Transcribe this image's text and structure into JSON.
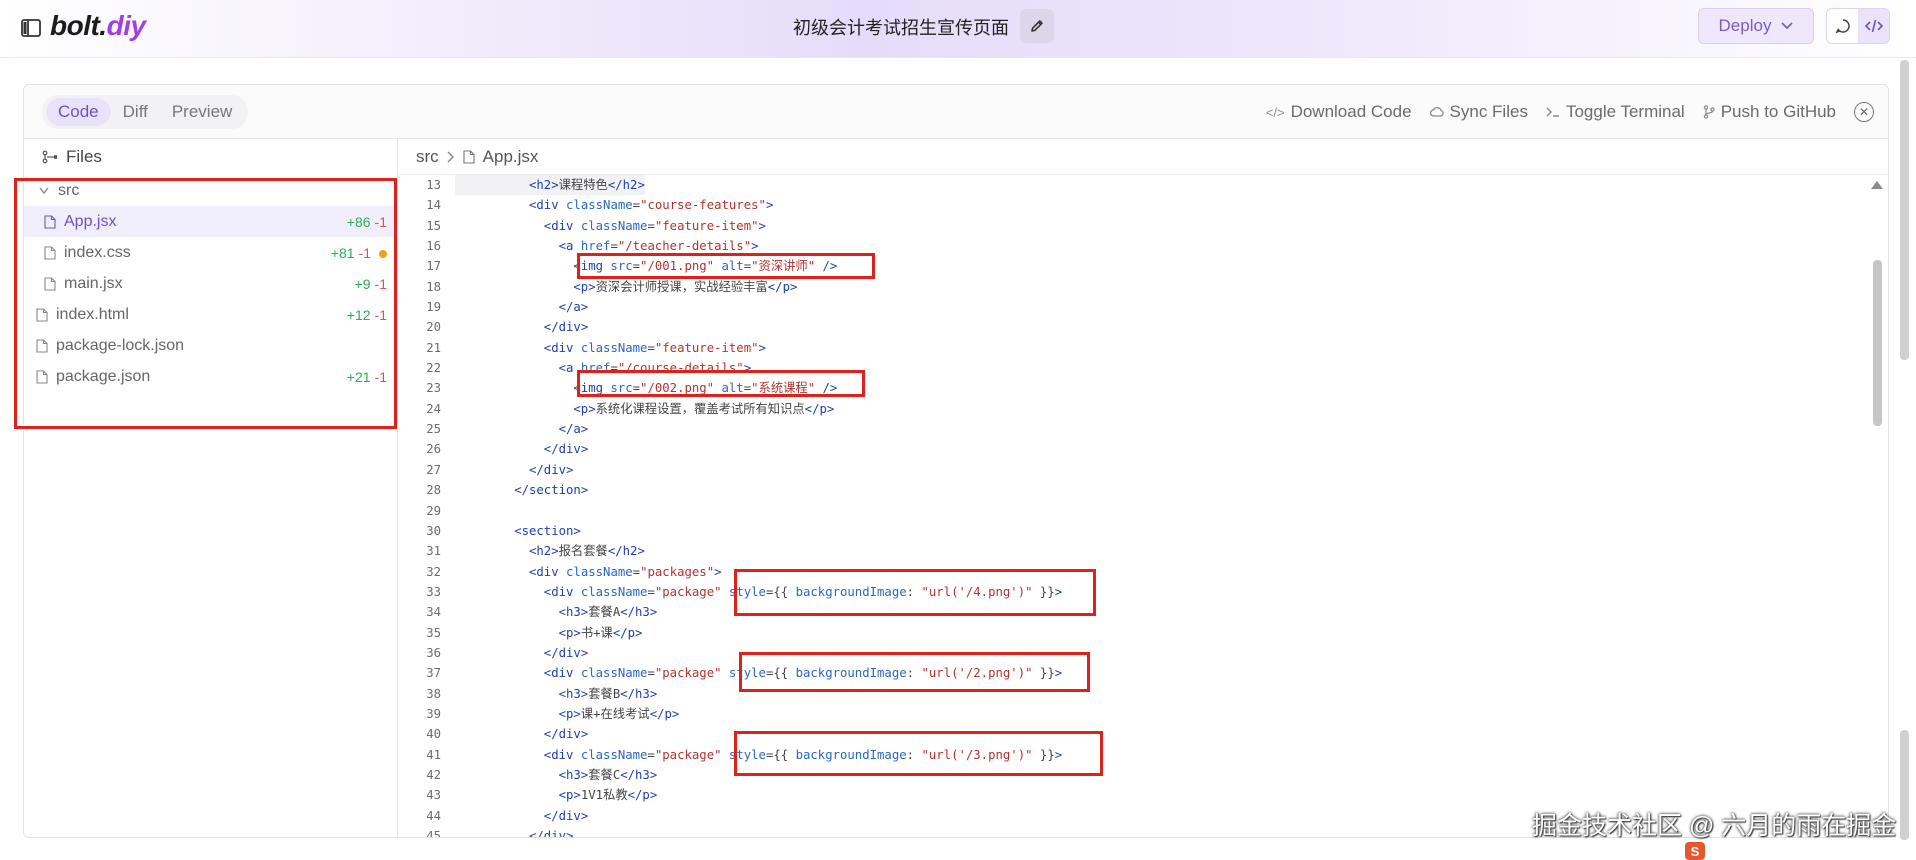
{
  "header": {
    "logo_main": "bolt.",
    "logo_accent": "diy",
    "project_title": "初级会计考试招生宣传页面",
    "deploy_label": "Deploy"
  },
  "workbench": {
    "tabs": [
      {
        "label": "Code",
        "active": true
      },
      {
        "label": "Diff",
        "active": false
      },
      {
        "label": "Preview",
        "active": false
      }
    ],
    "actions": {
      "download": "Download Code",
      "sync": "Sync Files",
      "terminal": "Toggle Terminal",
      "github": "Push to GitHub"
    }
  },
  "filetree": {
    "title": "Files",
    "items": [
      {
        "name": "src",
        "type": "folder",
        "indent": 0,
        "plus": "",
        "minus": "",
        "modified": false,
        "selected": false
      },
      {
        "name": "App.jsx",
        "type": "file",
        "indent": 1,
        "plus": "+86",
        "minus": "-1",
        "modified": false,
        "selected": true
      },
      {
        "name": "index.css",
        "type": "file",
        "indent": 1,
        "plus": "+81",
        "minus": "-1",
        "modified": true,
        "selected": false
      },
      {
        "name": "main.jsx",
        "type": "file",
        "indent": 1,
        "plus": "+9",
        "minus": "-1",
        "modified": false,
        "selected": false
      },
      {
        "name": "index.html",
        "type": "file",
        "indent": 0,
        "plus": "+12",
        "minus": "-1",
        "modified": false,
        "selected": false
      },
      {
        "name": "package-lock.json",
        "type": "file",
        "indent": 0,
        "plus": "",
        "minus": "",
        "modified": false,
        "selected": false
      },
      {
        "name": "package.json",
        "type": "file",
        "indent": 0,
        "plus": "+21",
        "minus": "-1",
        "modified": false,
        "selected": false
      }
    ]
  },
  "editor": {
    "breadcrumb": {
      "folder": "src",
      "file": "App.jsx"
    },
    "lines": [
      {
        "n": "13",
        "i": 5,
        "hl": true,
        "t": [
          [
            "tg",
            "<h2>"
          ],
          [
            "pu",
            "课程特色"
          ],
          [
            "tg",
            "</h2>"
          ]
        ]
      },
      {
        "n": "14",
        "i": 5,
        "t": [
          [
            "tg",
            "<div "
          ],
          [
            "at",
            "className"
          ],
          [
            "pu",
            "="
          ],
          [
            "st",
            "\"course-features\""
          ],
          [
            "tg",
            ">"
          ]
        ]
      },
      {
        "n": "15",
        "i": 6,
        "t": [
          [
            "tg",
            "<div "
          ],
          [
            "at",
            "className"
          ],
          [
            "pu",
            "="
          ],
          [
            "st",
            "\"feature-item\""
          ],
          [
            "tg",
            ">"
          ]
        ]
      },
      {
        "n": "16",
        "i": 7,
        "t": [
          [
            "tg",
            "<a "
          ],
          [
            "at",
            "href"
          ],
          [
            "pu",
            "="
          ],
          [
            "st",
            "\"/teacher-details\""
          ],
          [
            "tg",
            ">"
          ]
        ]
      },
      {
        "n": "17",
        "i": 8,
        "t": [
          [
            "tg",
            "<img "
          ],
          [
            "at",
            "src"
          ],
          [
            "pu",
            "="
          ],
          [
            "st",
            "\"/001.png\""
          ],
          [
            "pu",
            " "
          ],
          [
            "at",
            "alt"
          ],
          [
            "pu",
            "="
          ],
          [
            "st",
            "\"资深讲师\""
          ],
          [
            "tg",
            " />"
          ]
        ]
      },
      {
        "n": "18",
        "i": 8,
        "t": [
          [
            "tg",
            "<p>"
          ],
          [
            "pu",
            "资深会计师授课，实战经验丰富"
          ],
          [
            "tg",
            "</p>"
          ]
        ]
      },
      {
        "n": "19",
        "i": 7,
        "t": [
          [
            "tg",
            "</a>"
          ]
        ]
      },
      {
        "n": "20",
        "i": 6,
        "t": [
          [
            "tg",
            "</div>"
          ]
        ]
      },
      {
        "n": "21",
        "i": 6,
        "t": [
          [
            "tg",
            "<div "
          ],
          [
            "at",
            "className"
          ],
          [
            "pu",
            "="
          ],
          [
            "st",
            "\"feature-item\""
          ],
          [
            "tg",
            ">"
          ]
        ]
      },
      {
        "n": "22",
        "i": 7,
        "t": [
          [
            "tg",
            "<a "
          ],
          [
            "at",
            "href"
          ],
          [
            "pu",
            "="
          ],
          [
            "st",
            "\"/course-details\""
          ],
          [
            "tg",
            ">"
          ]
        ]
      },
      {
        "n": "23",
        "i": 8,
        "t": [
          [
            "tg",
            "<img "
          ],
          [
            "at",
            "src"
          ],
          [
            "pu",
            "="
          ],
          [
            "st",
            "\"/002.png\""
          ],
          [
            "pu",
            " "
          ],
          [
            "at",
            "alt"
          ],
          [
            "pu",
            "="
          ],
          [
            "st",
            "\"系统课程\""
          ],
          [
            "tg",
            " />"
          ]
        ]
      },
      {
        "n": "24",
        "i": 8,
        "t": [
          [
            "tg",
            "<p>"
          ],
          [
            "pu",
            "系统化课程设置，覆盖考试所有知识点"
          ],
          [
            "tg",
            "</p>"
          ]
        ]
      },
      {
        "n": "25",
        "i": 7,
        "t": [
          [
            "tg",
            "</a>"
          ]
        ]
      },
      {
        "n": "26",
        "i": 6,
        "t": [
          [
            "tg",
            "</div>"
          ]
        ]
      },
      {
        "n": "27",
        "i": 5,
        "t": [
          [
            "tg",
            "</div>"
          ]
        ]
      },
      {
        "n": "28",
        "i": 4,
        "t": [
          [
            "tg",
            "</section>"
          ]
        ]
      },
      {
        "n": "29",
        "i": 0,
        "t": []
      },
      {
        "n": "30",
        "i": 4,
        "t": [
          [
            "tg",
            "<section>"
          ]
        ]
      },
      {
        "n": "31",
        "i": 5,
        "t": [
          [
            "tg",
            "<h2>"
          ],
          [
            "pu",
            "报名套餐"
          ],
          [
            "tg",
            "</h2>"
          ]
        ]
      },
      {
        "n": "32",
        "i": 5,
        "t": [
          [
            "tg",
            "<div "
          ],
          [
            "at",
            "className"
          ],
          [
            "pu",
            "="
          ],
          [
            "st",
            "\"packages\""
          ],
          [
            "tg",
            ">"
          ]
        ]
      },
      {
        "n": "33",
        "i": 6,
        "t": [
          [
            "tg",
            "<div "
          ],
          [
            "at",
            "className"
          ],
          [
            "pu",
            "="
          ],
          [
            "st",
            "\"package\""
          ],
          [
            "pu",
            " "
          ],
          [
            "at",
            "style"
          ],
          [
            "pu",
            "={{ "
          ],
          [
            "at",
            "backgroundImage"
          ],
          [
            "pu",
            ": "
          ],
          [
            "st",
            "\"url('/4.png')\""
          ],
          [
            "pu",
            " }}"
          ],
          [
            "tg",
            ">"
          ]
        ]
      },
      {
        "n": "34",
        "i": 7,
        "t": [
          [
            "tg",
            "<h3>"
          ],
          [
            "pu",
            "套餐A"
          ],
          [
            "tg",
            "</h3>"
          ]
        ]
      },
      {
        "n": "35",
        "i": 7,
        "t": [
          [
            "tg",
            "<p>"
          ],
          [
            "pu",
            "书+课"
          ],
          [
            "tg",
            "</p>"
          ]
        ]
      },
      {
        "n": "36",
        "i": 6,
        "t": [
          [
            "tg",
            "</div>"
          ]
        ]
      },
      {
        "n": "37",
        "i": 6,
        "t": [
          [
            "tg",
            "<div "
          ],
          [
            "at",
            "className"
          ],
          [
            "pu",
            "="
          ],
          [
            "st",
            "\"package\""
          ],
          [
            "pu",
            " "
          ],
          [
            "at",
            "style"
          ],
          [
            "pu",
            "={{ "
          ],
          [
            "at",
            "backgroundImage"
          ],
          [
            "pu",
            ": "
          ],
          [
            "st",
            "\"url('/2.png')\""
          ],
          [
            "pu",
            " }}"
          ],
          [
            "tg",
            ">"
          ]
        ]
      },
      {
        "n": "38",
        "i": 7,
        "t": [
          [
            "tg",
            "<h3>"
          ],
          [
            "pu",
            "套餐B"
          ],
          [
            "tg",
            "</h3>"
          ]
        ]
      },
      {
        "n": "39",
        "i": 7,
        "t": [
          [
            "tg",
            "<p>"
          ],
          [
            "pu",
            "课+在线考试"
          ],
          [
            "tg",
            "</p>"
          ]
        ]
      },
      {
        "n": "40",
        "i": 6,
        "t": [
          [
            "tg",
            "</div>"
          ]
        ]
      },
      {
        "n": "41",
        "i": 6,
        "t": [
          [
            "tg",
            "<div "
          ],
          [
            "at",
            "className"
          ],
          [
            "pu",
            "="
          ],
          [
            "st",
            "\"package\""
          ],
          [
            "pu",
            " "
          ],
          [
            "at",
            "style"
          ],
          [
            "pu",
            "={{ "
          ],
          [
            "at",
            "backgroundImage"
          ],
          [
            "pu",
            ": "
          ],
          [
            "st",
            "\"url('/3.png')\""
          ],
          [
            "pu",
            " }}"
          ],
          [
            "tg",
            ">"
          ]
        ]
      },
      {
        "n": "42",
        "i": 7,
        "t": [
          [
            "tg",
            "<h3>"
          ],
          [
            "pu",
            "套餐C"
          ],
          [
            "tg",
            "</h3>"
          ]
        ]
      },
      {
        "n": "43",
        "i": 7,
        "t": [
          [
            "tg",
            "<p>"
          ],
          [
            "pu",
            "1V1私教"
          ],
          [
            "tg",
            "</p>"
          ]
        ]
      },
      {
        "n": "44",
        "i": 6,
        "t": [
          [
            "tg",
            "</div>"
          ]
        ]
      },
      {
        "n": "45",
        "i": 5,
        "t": [
          [
            "tg",
            "</div>"
          ]
        ]
      }
    ]
  },
  "watermark": {
    "text": "掘金技术社区 @ 六月的雨在掘金",
    "badge": "S"
  },
  "colors": {
    "accent": "#7150cb",
    "added": "#2fae4e",
    "removed": "#d9564f",
    "modified_dot": "#f3a01c",
    "highlight_box": "#e0201b"
  }
}
